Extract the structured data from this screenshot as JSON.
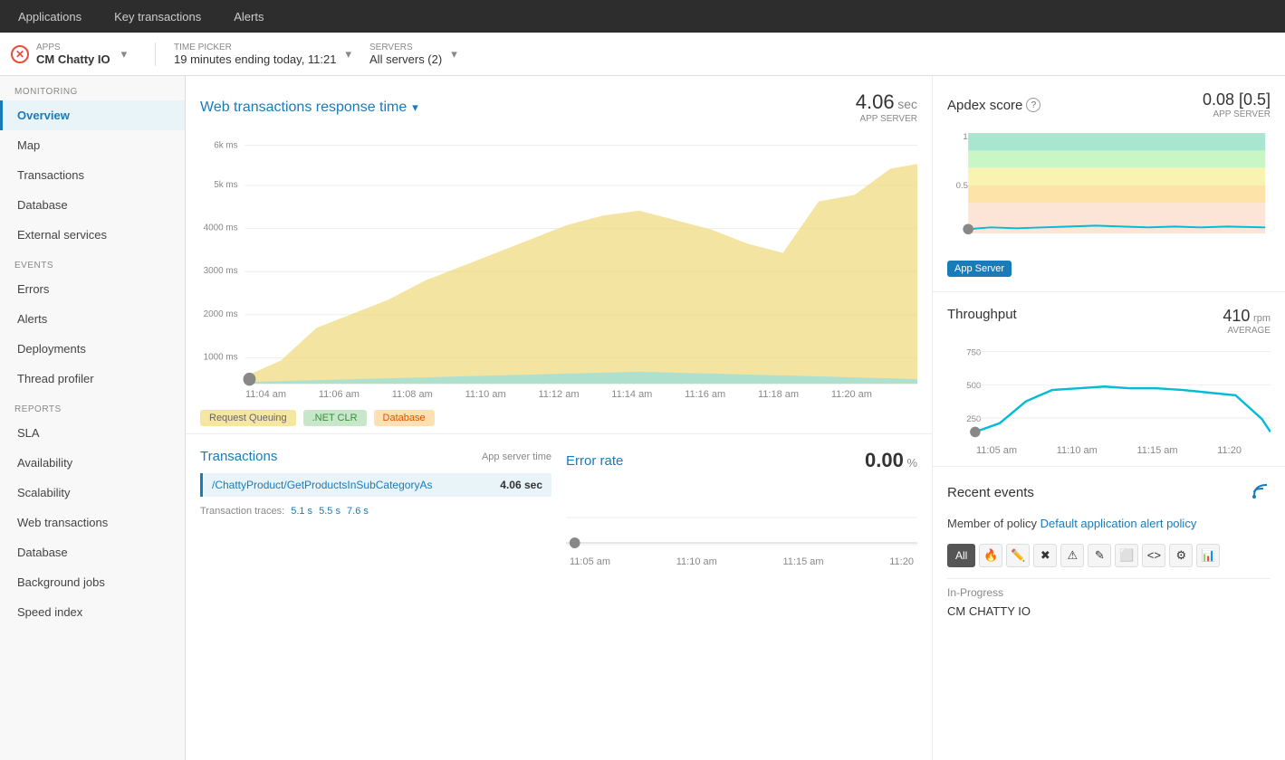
{
  "topNav": {
    "items": [
      "Applications",
      "Key transactions",
      "Alerts"
    ]
  },
  "appBar": {
    "appsLabel": "APPS",
    "appName": "CM Chatty IO",
    "timePicker": {
      "label": "TIME PICKER",
      "value": "19 minutes ending today, 11:21"
    },
    "servers": {
      "label": "SERVERS",
      "value": "All servers (2)"
    }
  },
  "sidebar": {
    "monitoringLabel": "MONITORING",
    "monitoringItems": [
      {
        "id": "overview",
        "label": "Overview",
        "active": true
      },
      {
        "id": "map",
        "label": "Map",
        "active": false
      },
      {
        "id": "transactions",
        "label": "Transactions",
        "active": false
      },
      {
        "id": "database",
        "label": "Database",
        "active": false
      },
      {
        "id": "external-services",
        "label": "External services",
        "active": false
      }
    ],
    "eventsLabel": "EVENTS",
    "eventsItems": [
      {
        "id": "errors",
        "label": "Errors",
        "active": false
      },
      {
        "id": "alerts",
        "label": "Alerts",
        "active": false
      },
      {
        "id": "deployments",
        "label": "Deployments",
        "active": false
      },
      {
        "id": "thread-profiler",
        "label": "Thread profiler",
        "active": false
      }
    ],
    "reportsLabel": "REPORTS",
    "reportsItems": [
      {
        "id": "sla",
        "label": "SLA",
        "active": false
      },
      {
        "id": "availability",
        "label": "Availability",
        "active": false
      },
      {
        "id": "scalability",
        "label": "Scalability",
        "active": false
      },
      {
        "id": "web-transactions",
        "label": "Web transactions",
        "active": false
      },
      {
        "id": "db",
        "label": "Database",
        "active": false
      },
      {
        "id": "background-jobs",
        "label": "Background jobs",
        "active": false
      },
      {
        "id": "speed-index",
        "label": "Speed index",
        "active": false
      }
    ]
  },
  "mainChart": {
    "title": "Web transactions response time",
    "value": "4.06",
    "unit": "sec",
    "subLabel": "APP SERVER",
    "yLabels": [
      "6k ms",
      "5k ms",
      "4000 ms",
      "3000 ms",
      "2000 ms",
      "1000 ms"
    ],
    "xLabels": [
      "11:04 am",
      "11:06 am",
      "11:08 am",
      "11:10 am",
      "11:12 am",
      "11:14 am",
      "11:16 am",
      "11:18 am",
      "11:20 am"
    ],
    "legend": [
      {
        "label": "Request Queuing",
        "color": "yellow"
      },
      {
        "label": ".NET CLR",
        "color": "green"
      },
      {
        "label": "Database",
        "color": "orange"
      }
    ]
  },
  "transactions": {
    "title": "Transactions",
    "columnLabel": "App server time",
    "topTransaction": {
      "name": "/ChattyProduct/GetProductsInSubCategoryAs",
      "time": "4.06 sec"
    },
    "traces": {
      "label": "Transaction traces:",
      "values": [
        "5.1 s",
        "5.5 s",
        "7.6 s"
      ]
    }
  },
  "errorRate": {
    "title": "Error rate",
    "value": "0.00",
    "unit": "%",
    "xLabels": [
      "11:05 am",
      "11:10 am",
      "11:15 am",
      "11:20"
    ]
  },
  "apdex": {
    "title": "Apdex score",
    "value": "0.08 [0.5]",
    "subLabel": "APP SERVER",
    "yLabels": [
      "1",
      "0.5"
    ],
    "appServerBadge": "App Server",
    "xLabels": []
  },
  "throughput": {
    "title": "Throughput",
    "value": "410",
    "unit": "rpm",
    "avgLabel": "AVERAGE",
    "yLabels": [
      "750",
      "500",
      "250"
    ],
    "xLabels": [
      "11:05 am",
      "11:10 am",
      "11:15 am",
      "11:20"
    ]
  },
  "recentEvents": {
    "title": "Recent events",
    "policyText": "Member of policy",
    "policyLink": "Default application alert policy",
    "filterButtons": [
      "All"
    ],
    "filterIcons": [
      "🔥",
      "✏️",
      "✖️",
      "⚠️",
      "✎",
      "⬜",
      "<>",
      "⚙️",
      "📊"
    ],
    "inProgressLabel": "In-Progress",
    "eventName": "CM CHATTY IO"
  }
}
